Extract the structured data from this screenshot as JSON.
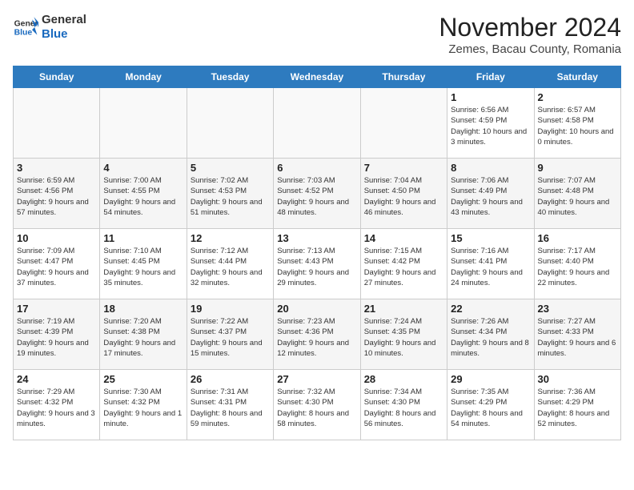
{
  "header": {
    "logo_general": "General",
    "logo_blue": "Blue",
    "month_title": "November 2024",
    "location": "Zemes, Bacau County, Romania"
  },
  "days_of_week": [
    "Sunday",
    "Monday",
    "Tuesday",
    "Wednesday",
    "Thursday",
    "Friday",
    "Saturday"
  ],
  "weeks": [
    [
      {
        "day": "",
        "info": ""
      },
      {
        "day": "",
        "info": ""
      },
      {
        "day": "",
        "info": ""
      },
      {
        "day": "",
        "info": ""
      },
      {
        "day": "",
        "info": ""
      },
      {
        "day": "1",
        "info": "Sunrise: 6:56 AM\nSunset: 4:59 PM\nDaylight: 10 hours and 3 minutes."
      },
      {
        "day": "2",
        "info": "Sunrise: 6:57 AM\nSunset: 4:58 PM\nDaylight: 10 hours and 0 minutes."
      }
    ],
    [
      {
        "day": "3",
        "info": "Sunrise: 6:59 AM\nSunset: 4:56 PM\nDaylight: 9 hours and 57 minutes."
      },
      {
        "day": "4",
        "info": "Sunrise: 7:00 AM\nSunset: 4:55 PM\nDaylight: 9 hours and 54 minutes."
      },
      {
        "day": "5",
        "info": "Sunrise: 7:02 AM\nSunset: 4:53 PM\nDaylight: 9 hours and 51 minutes."
      },
      {
        "day": "6",
        "info": "Sunrise: 7:03 AM\nSunset: 4:52 PM\nDaylight: 9 hours and 48 minutes."
      },
      {
        "day": "7",
        "info": "Sunrise: 7:04 AM\nSunset: 4:50 PM\nDaylight: 9 hours and 46 minutes."
      },
      {
        "day": "8",
        "info": "Sunrise: 7:06 AM\nSunset: 4:49 PM\nDaylight: 9 hours and 43 minutes."
      },
      {
        "day": "9",
        "info": "Sunrise: 7:07 AM\nSunset: 4:48 PM\nDaylight: 9 hours and 40 minutes."
      }
    ],
    [
      {
        "day": "10",
        "info": "Sunrise: 7:09 AM\nSunset: 4:47 PM\nDaylight: 9 hours and 37 minutes."
      },
      {
        "day": "11",
        "info": "Sunrise: 7:10 AM\nSunset: 4:45 PM\nDaylight: 9 hours and 35 minutes."
      },
      {
        "day": "12",
        "info": "Sunrise: 7:12 AM\nSunset: 4:44 PM\nDaylight: 9 hours and 32 minutes."
      },
      {
        "day": "13",
        "info": "Sunrise: 7:13 AM\nSunset: 4:43 PM\nDaylight: 9 hours and 29 minutes."
      },
      {
        "day": "14",
        "info": "Sunrise: 7:15 AM\nSunset: 4:42 PM\nDaylight: 9 hours and 27 minutes."
      },
      {
        "day": "15",
        "info": "Sunrise: 7:16 AM\nSunset: 4:41 PM\nDaylight: 9 hours and 24 minutes."
      },
      {
        "day": "16",
        "info": "Sunrise: 7:17 AM\nSunset: 4:40 PM\nDaylight: 9 hours and 22 minutes."
      }
    ],
    [
      {
        "day": "17",
        "info": "Sunrise: 7:19 AM\nSunset: 4:39 PM\nDaylight: 9 hours and 19 minutes."
      },
      {
        "day": "18",
        "info": "Sunrise: 7:20 AM\nSunset: 4:38 PM\nDaylight: 9 hours and 17 minutes."
      },
      {
        "day": "19",
        "info": "Sunrise: 7:22 AM\nSunset: 4:37 PM\nDaylight: 9 hours and 15 minutes."
      },
      {
        "day": "20",
        "info": "Sunrise: 7:23 AM\nSunset: 4:36 PM\nDaylight: 9 hours and 12 minutes."
      },
      {
        "day": "21",
        "info": "Sunrise: 7:24 AM\nSunset: 4:35 PM\nDaylight: 9 hours and 10 minutes."
      },
      {
        "day": "22",
        "info": "Sunrise: 7:26 AM\nSunset: 4:34 PM\nDaylight: 9 hours and 8 minutes."
      },
      {
        "day": "23",
        "info": "Sunrise: 7:27 AM\nSunset: 4:33 PM\nDaylight: 9 hours and 6 minutes."
      }
    ],
    [
      {
        "day": "24",
        "info": "Sunrise: 7:29 AM\nSunset: 4:32 PM\nDaylight: 9 hours and 3 minutes."
      },
      {
        "day": "25",
        "info": "Sunrise: 7:30 AM\nSunset: 4:32 PM\nDaylight: 9 hours and 1 minute."
      },
      {
        "day": "26",
        "info": "Sunrise: 7:31 AM\nSunset: 4:31 PM\nDaylight: 8 hours and 59 minutes."
      },
      {
        "day": "27",
        "info": "Sunrise: 7:32 AM\nSunset: 4:30 PM\nDaylight: 8 hours and 58 minutes."
      },
      {
        "day": "28",
        "info": "Sunrise: 7:34 AM\nSunset: 4:30 PM\nDaylight: 8 hours and 56 minutes."
      },
      {
        "day": "29",
        "info": "Sunrise: 7:35 AM\nSunset: 4:29 PM\nDaylight: 8 hours and 54 minutes."
      },
      {
        "day": "30",
        "info": "Sunrise: 7:36 AM\nSunset: 4:29 PM\nDaylight: 8 hours and 52 minutes."
      }
    ]
  ]
}
